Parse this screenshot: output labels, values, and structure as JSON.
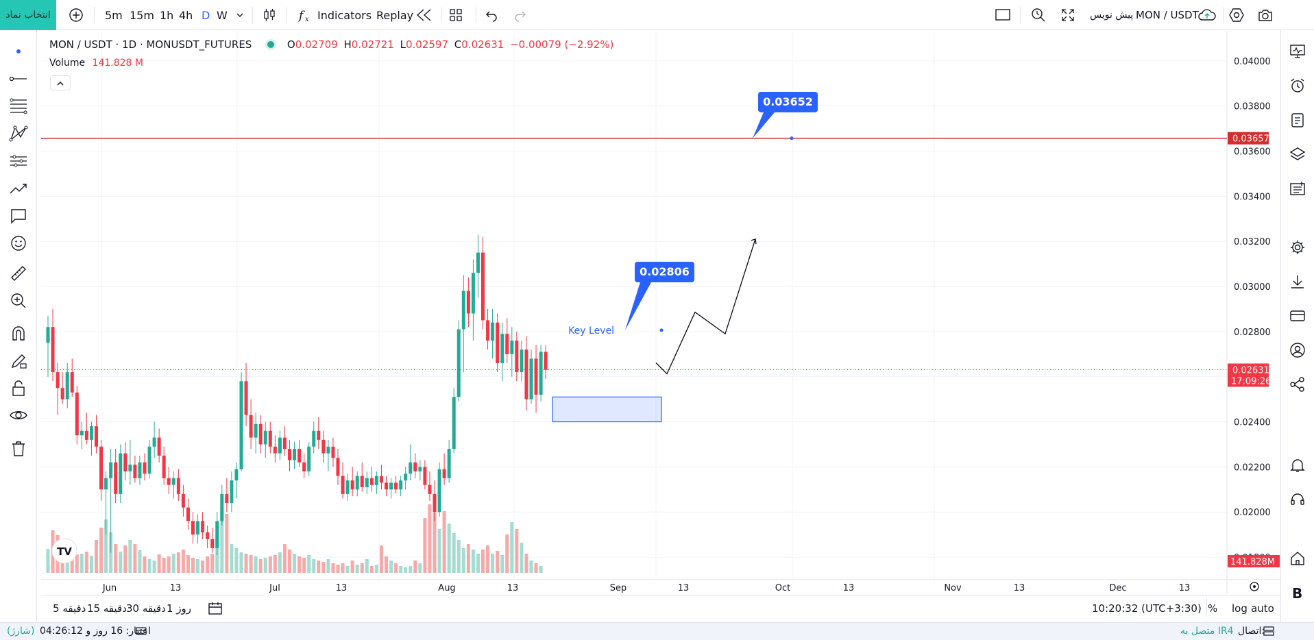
{
  "topbar": {
    "symbol_button": "انتخاب نماد",
    "timeframes": [
      "5m",
      "15m",
      "1h",
      "4h",
      "D",
      "W"
    ],
    "active_timeframe": "D",
    "indicators_label": "Indicators",
    "replay_label": "Replay",
    "symbol_title": "MON / USDT",
    "preview_label": "پیش نویس"
  },
  "legend": {
    "symbol": "MON / USDT · 1D · MONUSDT_FUTURES",
    "o_label": "O",
    "o_value": "0.02709",
    "h_label": "H",
    "h_value": "0.02721",
    "l_label": "L",
    "l_value": "0.02597",
    "c_label": "C",
    "c_value": "0.02631",
    "change": "−0.00079 (−2.92%)",
    "volume_label": "Volume",
    "volume_value": "141.828 M"
  },
  "price_axis": {
    "ticks": [
      "0.04000",
      "0.03800",
      "0.03600",
      "0.03400",
      "0.03200",
      "0.03000",
      "0.02800",
      "0.02400",
      "0.02200",
      "0.02000",
      "0.01800"
    ],
    "resistance_tag": "0.03657",
    "last_price_tag": "0.02631",
    "countdown": "17:09:26",
    "volume_tag": "141.828M"
  },
  "time_axis": {
    "labels": [
      "Jun",
      "13",
      "Jul",
      "13",
      "Aug",
      "13",
      "Sep",
      "13",
      "Oct",
      "13",
      "Nov",
      "13",
      "Dec",
      "13"
    ]
  },
  "annotations": {
    "resistance_callout": "0.03652",
    "key_level_callout": "0.02806",
    "key_level_text": "Key Level"
  },
  "chart_data": {
    "type": "candlestick",
    "title": "MON / USDT · 1D · MONUSDT_FUTURES",
    "ylim": [
      0.017,
      0.0413
    ],
    "resistance_level": 0.03657,
    "last_price": 0.02631,
    "demand_zone": [
      0.024,
      0.0251
    ],
    "up_color": "#22ab94",
    "down_color": "#f23645",
    "candles": [
      [
        0.0275,
        0.0287,
        0.026,
        0.0282
      ],
      [
        0.0282,
        0.029,
        0.0258,
        0.0262
      ],
      [
        0.0262,
        0.0266,
        0.0243,
        0.0255
      ],
      [
        0.0255,
        0.0262,
        0.0248,
        0.025
      ],
      [
        0.025,
        0.0266,
        0.0246,
        0.0262
      ],
      [
        0.0262,
        0.0268,
        0.0251,
        0.0253
      ],
      [
        0.0253,
        0.0256,
        0.023,
        0.0234
      ],
      [
        0.0234,
        0.024,
        0.0228,
        0.0236
      ],
      [
        0.0236,
        0.0244,
        0.023,
        0.0232
      ],
      [
        0.0232,
        0.024,
        0.0225,
        0.0238
      ],
      [
        0.0238,
        0.0243,
        0.0226,
        0.0229
      ],
      [
        0.0229,
        0.0232,
        0.0205,
        0.021
      ],
      [
        0.021,
        0.0218,
        0.019,
        0.0215
      ],
      [
        0.0215,
        0.0228,
        0.0182,
        0.0222
      ],
      [
        0.0222,
        0.0228,
        0.0204,
        0.0208
      ],
      [
        0.0208,
        0.023,
        0.0204,
        0.0226
      ],
      [
        0.0226,
        0.0231,
        0.0214,
        0.0218
      ],
      [
        0.0218,
        0.0232,
        0.0212,
        0.0221
      ],
      [
        0.0221,
        0.0225,
        0.0213,
        0.0215
      ],
      [
        0.0215,
        0.0225,
        0.0212,
        0.0222
      ],
      [
        0.0222,
        0.0226,
        0.0214,
        0.0217
      ],
      [
        0.0217,
        0.0232,
        0.0215,
        0.0229
      ],
      [
        0.0229,
        0.024,
        0.0224,
        0.0233
      ],
      [
        0.0233,
        0.0237,
        0.0222,
        0.0225
      ],
      [
        0.0225,
        0.0229,
        0.0212,
        0.0215
      ],
      [
        0.0215,
        0.022,
        0.0208,
        0.0212
      ],
      [
        0.0212,
        0.0218,
        0.0206,
        0.0215
      ],
      [
        0.0215,
        0.0219,
        0.0205,
        0.0208
      ],
      [
        0.0208,
        0.0212,
        0.0198,
        0.0202
      ],
      [
        0.0202,
        0.0206,
        0.0192,
        0.0196
      ],
      [
        0.0196,
        0.02,
        0.0186,
        0.019
      ],
      [
        0.019,
        0.0199,
        0.0186,
        0.0196
      ],
      [
        0.0196,
        0.02,
        0.0188,
        0.0191
      ],
      [
        0.0191,
        0.0194,
        0.0184,
        0.0188
      ],
      [
        0.0188,
        0.0193,
        0.0182,
        0.0184
      ],
      [
        0.0184,
        0.02,
        0.0181,
        0.0196
      ],
      [
        0.0196,
        0.0212,
        0.0194,
        0.0208
      ],
      [
        0.0208,
        0.0215,
        0.02,
        0.0204
      ],
      [
        0.0204,
        0.0218,
        0.02,
        0.0214
      ],
      [
        0.0214,
        0.0222,
        0.0206,
        0.0219
      ],
      [
        0.0219,
        0.0262,
        0.0218,
        0.0258
      ],
      [
        0.0258,
        0.0266,
        0.0238,
        0.0243
      ],
      [
        0.0243,
        0.025,
        0.0228,
        0.0233
      ],
      [
        0.0233,
        0.0244,
        0.0226,
        0.0239
      ],
      [
        0.0239,
        0.0243,
        0.0226,
        0.023
      ],
      [
        0.023,
        0.024,
        0.0224,
        0.0236
      ],
      [
        0.0236,
        0.024,
        0.0226,
        0.0229
      ],
      [
        0.0229,
        0.0234,
        0.0222,
        0.0226
      ],
      [
        0.0226,
        0.0236,
        0.0223,
        0.0233
      ],
      [
        0.0233,
        0.0238,
        0.0225,
        0.0228
      ],
      [
        0.0228,
        0.0232,
        0.0218,
        0.0223
      ],
      [
        0.0223,
        0.0231,
        0.0219,
        0.0228
      ],
      [
        0.0228,
        0.0232,
        0.022,
        0.0222
      ],
      [
        0.0222,
        0.0226,
        0.0215,
        0.0218
      ],
      [
        0.0218,
        0.0231,
        0.0216,
        0.0229
      ],
      [
        0.0229,
        0.024,
        0.0226,
        0.0236
      ],
      [
        0.0236,
        0.0242,
        0.0228,
        0.0232
      ],
      [
        0.0232,
        0.0236,
        0.0222,
        0.0226
      ],
      [
        0.0226,
        0.0232,
        0.0218,
        0.0229
      ],
      [
        0.0229,
        0.0233,
        0.022,
        0.0224
      ],
      [
        0.0224,
        0.0228,
        0.0212,
        0.0216
      ],
      [
        0.0216,
        0.0222,
        0.0206,
        0.0208
      ],
      [
        0.0208,
        0.0217,
        0.0205,
        0.0214
      ],
      [
        0.0214,
        0.022,
        0.0207,
        0.021
      ],
      [
        0.021,
        0.0218,
        0.0207,
        0.0216
      ],
      [
        0.0216,
        0.0222,
        0.0209,
        0.0211
      ],
      [
        0.0211,
        0.0218,
        0.0208,
        0.0215
      ],
      [
        0.0215,
        0.022,
        0.0209,
        0.0212
      ],
      [
        0.0212,
        0.0218,
        0.0208,
        0.0216
      ],
      [
        0.0216,
        0.0221,
        0.021,
        0.0213
      ],
      [
        0.0213,
        0.0216,
        0.0207,
        0.021
      ],
      [
        0.021,
        0.0215,
        0.0206,
        0.0213
      ],
      [
        0.0213,
        0.0216,
        0.0208,
        0.021
      ],
      [
        0.021,
        0.0216,
        0.0207,
        0.0214
      ],
      [
        0.0214,
        0.022,
        0.021,
        0.0217
      ],
      [
        0.0217,
        0.023,
        0.0214,
        0.0222
      ],
      [
        0.0222,
        0.0226,
        0.0215,
        0.0218
      ],
      [
        0.0218,
        0.0223,
        0.0214,
        0.022
      ],
      [
        0.022,
        0.0223,
        0.021,
        0.0212
      ],
      [
        0.0212,
        0.0218,
        0.0205,
        0.0208
      ],
      [
        0.0208,
        0.0214,
        0.0196,
        0.02
      ],
      [
        0.02,
        0.0222,
        0.0198,
        0.0219
      ],
      [
        0.0219,
        0.0226,
        0.0212,
        0.0215
      ],
      [
        0.0215,
        0.0232,
        0.0213,
        0.0228
      ],
      [
        0.0228,
        0.0255,
        0.0226,
        0.0251
      ],
      [
        0.0251,
        0.0285,
        0.0249,
        0.0281
      ],
      [
        0.0281,
        0.0305,
        0.0262,
        0.0298
      ],
      [
        0.0298,
        0.0304,
        0.0282,
        0.0288
      ],
      [
        0.0288,
        0.0312,
        0.0276,
        0.0306
      ],
      [
        0.0306,
        0.0323,
        0.0295,
        0.0315
      ],
      [
        0.0315,
        0.0322,
        0.0281,
        0.0285
      ],
      [
        0.0285,
        0.029,
        0.0272,
        0.0276
      ],
      [
        0.0276,
        0.029,
        0.0268,
        0.0284
      ],
      [
        0.0284,
        0.0288,
        0.0262,
        0.0266
      ],
      [
        0.0266,
        0.0284,
        0.0258,
        0.0279
      ],
      [
        0.0279,
        0.0286,
        0.0266,
        0.027
      ],
      [
        0.027,
        0.0282,
        0.026,
        0.0276
      ],
      [
        0.0276,
        0.028,
        0.0258,
        0.0262
      ],
      [
        0.0262,
        0.0276,
        0.0258,
        0.0272
      ],
      [
        0.0272,
        0.0278,
        0.0245,
        0.025
      ],
      [
        0.025,
        0.0272,
        0.0248,
        0.0268
      ],
      [
        0.0268,
        0.0274,
        0.0244,
        0.0252
      ],
      [
        0.0252,
        0.0274,
        0.0249,
        0.0271
      ],
      [
        0.0271,
        0.0274,
        0.0259,
        0.0263
      ]
    ],
    "volumes": [
      0.35,
      0.62,
      0.55,
      0.3,
      0.38,
      0.44,
      0.27,
      0.28,
      0.31,
      0.25,
      0.48,
      0.66,
      0.78,
      0.59,
      0.42,
      0.31,
      0.4,
      0.48,
      0.42,
      0.33,
      0.24,
      0.2,
      0.18,
      0.27,
      0.22,
      0.24,
      0.28,
      0.3,
      0.34,
      0.26,
      0.22,
      0.2,
      0.18,
      0.24,
      0.28,
      0.52,
      0.9,
      0.86,
      0.42,
      0.36,
      0.3,
      0.28,
      0.26,
      0.24,
      0.2,
      0.22,
      0.24,
      0.26,
      0.3,
      0.42,
      0.34,
      0.28,
      0.24,
      0.22,
      0.26,
      0.2,
      0.18,
      0.16,
      0.2,
      0.14,
      0.12,
      0.14,
      0.1,
      0.18,
      0.12,
      0.14,
      0.2,
      0.1,
      0.12,
      0.4,
      0.24,
      0.18,
      0.14,
      0.1,
      0.08,
      0.1,
      0.18,
      0.14,
      0.8,
      1.0,
      0.88,
      0.64,
      0.9,
      0.72,
      0.58,
      0.48,
      0.36,
      0.42,
      0.34,
      0.28,
      0.34,
      0.4,
      0.28,
      0.32,
      0.26,
      0.56,
      0.74,
      0.64,
      0.44,
      0.28,
      0.18,
      0.14,
      0.1
    ]
  },
  "bottombar": {
    "timeframe_buttons": [
      "دقیقه 5",
      "دقیقه 15",
      "دقیقه 30",
      "روز 1"
    ],
    "clock": "10:20:32 (UTC+3:30)",
    "percent": "%",
    "log": "log",
    "auto": "auto"
  },
  "statusbar": {
    "credit": "اعتبار: 16 روز و 04:26:12",
    "charge": "(شارژ)",
    "connection_label": "اتصال:",
    "connection_value": "متصل به IR4"
  }
}
